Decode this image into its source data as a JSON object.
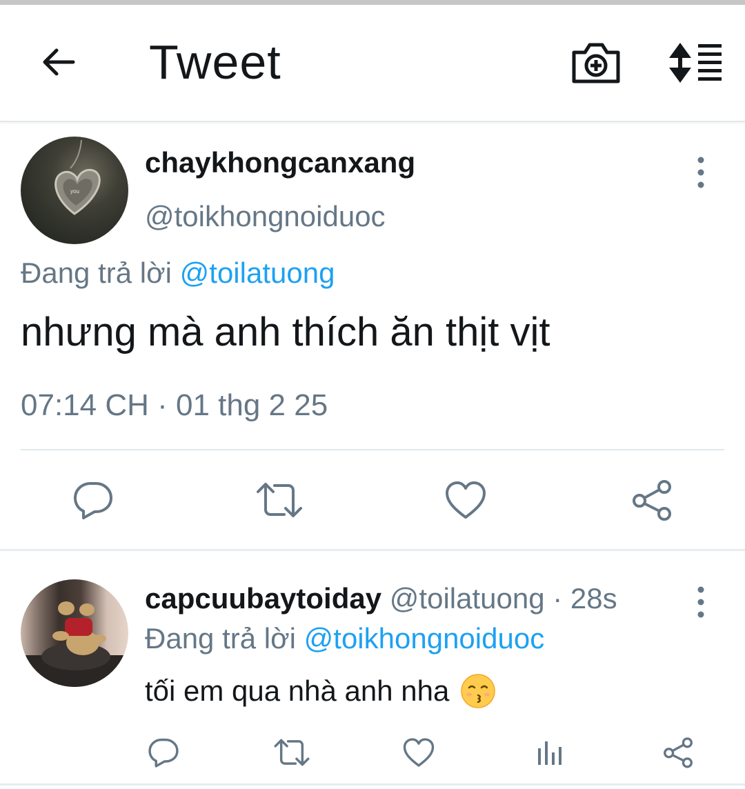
{
  "header": {
    "title": "Tweet",
    "back_icon": "arrow-left-icon",
    "camera_icon": "camera-plus-icon",
    "sort_icon": "sort-list-icon"
  },
  "tweet": {
    "display_name": "chaykhongcanxang",
    "handle": "@toikhongnoiduoc",
    "replying_prefix": "Đang trả lời",
    "replying_to": "@toilatuong",
    "text": "nhưng mà anh thích ăn thịt vịt",
    "timestamp": "07:14 CH · 01 thg 2 25",
    "actions": [
      "reply-icon",
      "retweet-icon",
      "like-icon",
      "share-icon"
    ]
  },
  "reply": {
    "display_name": "capcuubaytoiday",
    "handle": "@toilatuong",
    "time": "· 28s",
    "replying_prefix": "Đang trả lời",
    "replying_to": "@toikhongnoiduoc",
    "text": "tối em qua nhà anh nha",
    "emoji": "kissing-face-smiling-eyes-icon",
    "actions": [
      "reply-icon",
      "retweet-icon",
      "like-icon",
      "analytics-icon",
      "share-icon"
    ]
  },
  "colors": {
    "text": "#14171a",
    "secondary": "#657786",
    "link": "#1da1f2",
    "divider": "#e1e8ed"
  }
}
